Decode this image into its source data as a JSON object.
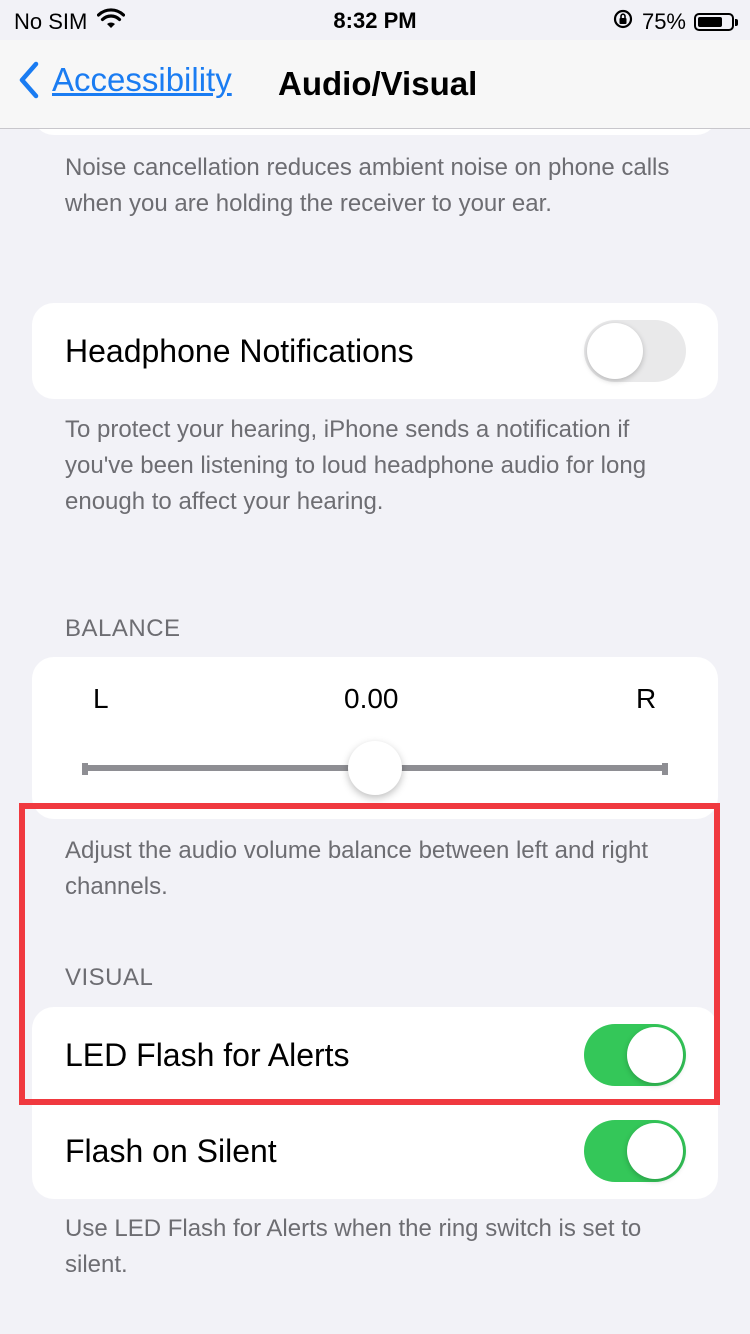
{
  "status_bar": {
    "carrier": "No SIM",
    "time": "8:32 PM",
    "battery_percent": "75%",
    "battery_level": 0.75
  },
  "nav": {
    "back_label": "Accessibility",
    "title": "Audio/Visual"
  },
  "noise_cancellation_footer": "Noise cancellation reduces ambient noise on phone calls when you are holding the receiver to your ear.",
  "headphone": {
    "label": "Headphone Notifications",
    "enabled": false,
    "footer": "To protect your hearing, iPhone sends a notification if you've been listening to loud headphone audio for long enough to affect your hearing."
  },
  "balance": {
    "header": "BALANCE",
    "left_label": "L",
    "right_label": "R",
    "value_text": "0.00",
    "value": 0,
    "footer": "Adjust the audio volume balance between left and right channels."
  },
  "visual": {
    "header": "VISUAL",
    "led_flash_label": "LED Flash for Alerts",
    "led_flash_enabled": true,
    "flash_silent_label": "Flash on Silent",
    "flash_silent_enabled": true,
    "footer": "Use LED Flash for Alerts when the ring switch is set to silent."
  },
  "colors": {
    "accent": "#1a7cf2",
    "toggle_on": "#34c759",
    "highlight": "#f0393f"
  },
  "icons": {
    "back": "chevron-left-icon",
    "wifi": "wifi-icon",
    "orientation_lock": "orientation-lock-icon",
    "battery": "battery-icon"
  }
}
